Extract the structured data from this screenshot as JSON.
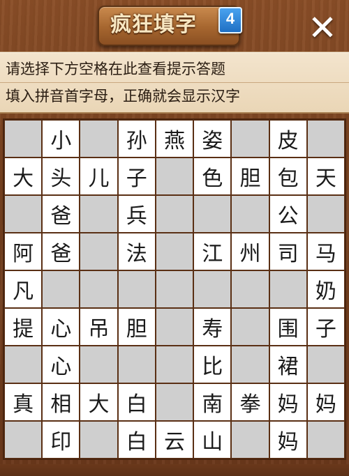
{
  "header": {
    "title": "疯狂填字",
    "level": "4",
    "close_label": "✕"
  },
  "hint": {
    "line1": "请选择下方空格在此查看提示答题",
    "line2": "填入拼音首字母，正确就会显示汉字"
  },
  "board": {
    "rows": [
      [
        "",
        "小",
        "",
        "孙",
        "燕",
        "姿",
        "",
        "皮",
        ""
      ],
      [
        "大",
        "头",
        "儿",
        "子",
        "",
        "色",
        "胆",
        "包",
        "天"
      ],
      [
        "",
        "爸",
        "",
        "兵",
        "",
        "",
        "",
        "公",
        ""
      ],
      [
        "阿",
        "爸",
        "",
        "法",
        "",
        "江",
        "州",
        "司",
        "马"
      ],
      [
        "凡",
        "",
        "",
        "",
        "",
        "",
        "",
        "",
        "奶"
      ],
      [
        "提",
        "心",
        "吊",
        "胆",
        "",
        "寿",
        "",
        "围",
        "子"
      ],
      [
        "",
        "心",
        "",
        "",
        "",
        "比",
        "",
        "裙",
        ""
      ],
      [
        "真",
        "相",
        "大",
        "白",
        "",
        "南",
        "拳",
        "妈",
        "妈"
      ],
      [
        "",
        "印",
        "",
        "白",
        "云",
        "山",
        "",
        "妈",
        ""
      ]
    ],
    "open_cells": [
      [
        0,
        1
      ],
      [
        0,
        3
      ],
      [
        0,
        4
      ],
      [
        0,
        5
      ],
      [
        0,
        7
      ],
      [
        1,
        0
      ],
      [
        1,
        1
      ],
      [
        1,
        2
      ],
      [
        1,
        3
      ],
      [
        1,
        5
      ],
      [
        1,
        6
      ],
      [
        1,
        7
      ],
      [
        1,
        8
      ],
      [
        2,
        1
      ],
      [
        2,
        3
      ],
      [
        2,
        7
      ],
      [
        3,
        0
      ],
      [
        3,
        1
      ],
      [
        3,
        3
      ],
      [
        3,
        5
      ],
      [
        3,
        6
      ],
      [
        3,
        7
      ],
      [
        3,
        8
      ],
      [
        4,
        0
      ],
      [
        4,
        8
      ],
      [
        5,
        0
      ],
      [
        5,
        1
      ],
      [
        5,
        2
      ],
      [
        5,
        3
      ],
      [
        5,
        5
      ],
      [
        5,
        7
      ],
      [
        5,
        8
      ],
      [
        6,
        1
      ],
      [
        6,
        5
      ],
      [
        6,
        7
      ],
      [
        7,
        0
      ],
      [
        7,
        1
      ],
      [
        7,
        2
      ],
      [
        7,
        3
      ],
      [
        7,
        5
      ],
      [
        7,
        6
      ],
      [
        7,
        7
      ],
      [
        7,
        8
      ],
      [
        8,
        1
      ],
      [
        8,
        3
      ],
      [
        8,
        4
      ],
      [
        8,
        5
      ],
      [
        8,
        7
      ]
    ]
  }
}
